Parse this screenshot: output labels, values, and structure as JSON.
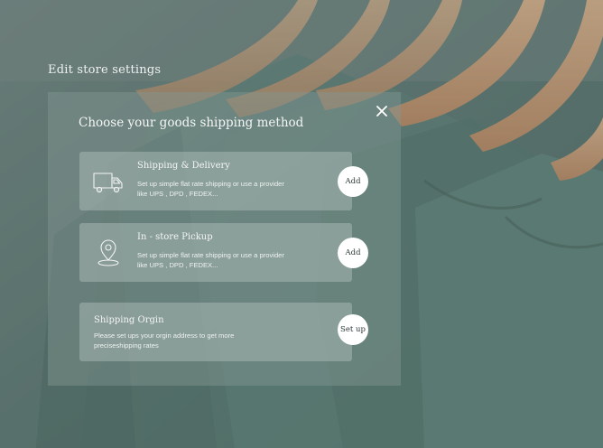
{
  "page": {
    "title": "Edit store settings"
  },
  "modal": {
    "title": "Choose your goods shipping method",
    "close_icon": "close-icon",
    "options": [
      {
        "icon": "truck-icon",
        "title": "Shipping & Delivery",
        "description": "Set up simple flat rate shipping or use a provider like UPS , DPD , FEDEX...",
        "button_label": "Add"
      },
      {
        "icon": "location-pin-icon",
        "title": "In - store Pickup",
        "description": "Set up simple flat rate shipping or use a provider like UPS , DPD , FEDEX...",
        "button_label": "Add"
      },
      {
        "title": "Shipping Orgin",
        "description": "Please set ups your orgin address to get more preciseshipping rates",
        "button_label": "Set up"
      }
    ]
  },
  "colors": {
    "background": "#5f7772",
    "button": "#ffffff",
    "text": "#f3f5f4"
  }
}
